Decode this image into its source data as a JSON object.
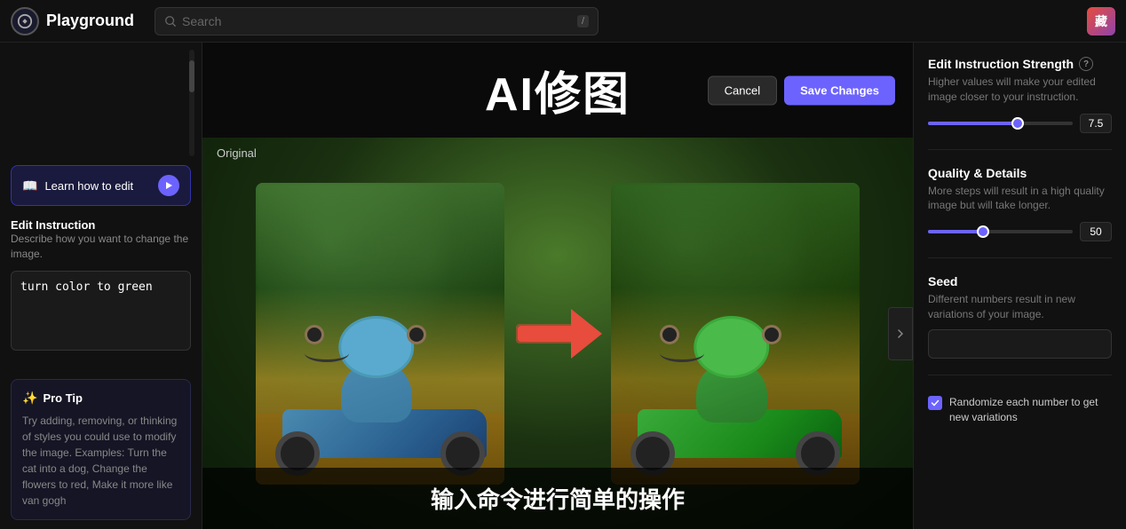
{
  "nav": {
    "logo_label": "Playground",
    "search_placeholder": "Search",
    "kbd_hint": "/",
    "avatar_text": "藏"
  },
  "sidebar": {
    "learn_btn_label": "Learn how to edit",
    "edit_instruction_title": "Edit Instruction",
    "edit_instruction_desc": "Describe how you want to change the image.",
    "instruction_value": "turn color to green",
    "pro_tip_title": "Pro Tip",
    "pro_tip_text": "Try adding, removing, or thinking of styles you could use to modify the image. Examples: Turn the cat into a dog, Change the flowers to red, Make it more like van gogh"
  },
  "center": {
    "title": "AI修图",
    "cancel_label": "Cancel",
    "save_label": "Save Changes",
    "original_label": "Original",
    "caption_zh": "输入命令进行简单的操作"
  },
  "right": {
    "strength_title": "Edit Instruction Strength",
    "strength_desc": "Higher values will make your edited image closer to your instruction.",
    "strength_value": "7.5",
    "strength_percent": 62,
    "quality_title": "Quality & Details",
    "quality_desc": "More steps will result in a high quality image but will take longer.",
    "quality_value": "50",
    "quality_percent": 38,
    "seed_title": "Seed",
    "seed_desc": "Different numbers result in new variations of your image.",
    "seed_value": "",
    "seed_placeholder": "",
    "randomize_label": "Randomize each number to get new variations"
  }
}
